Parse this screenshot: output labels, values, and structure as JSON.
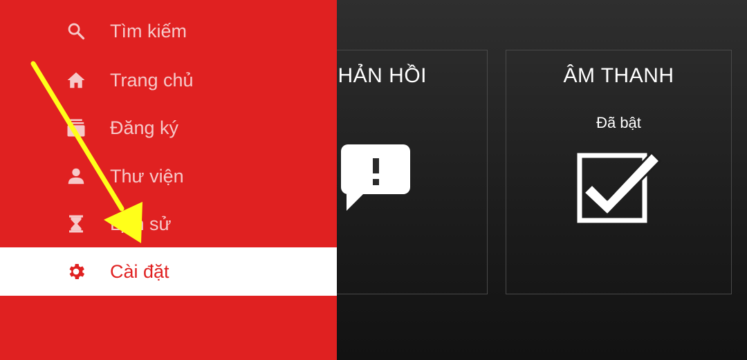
{
  "drawer": {
    "items": [
      {
        "label": "Tìm kiếm",
        "icon": "search-icon",
        "active": false
      },
      {
        "label": "Trang chủ",
        "icon": "home-icon",
        "active": false
      },
      {
        "label": "Đăng ký",
        "icon": "subscriptions-icon",
        "active": false
      },
      {
        "label": "Thư viện",
        "icon": "person-icon",
        "active": false
      },
      {
        "label": "Lịch sử",
        "icon": "hourglass-icon",
        "active": false
      },
      {
        "label": "Cài đặt",
        "icon": "gear-icon",
        "active": true
      }
    ]
  },
  "settings": {
    "feedback": {
      "title": "HẢN HỒI"
    },
    "sound": {
      "title": "ÂM THANH",
      "status": "Đã bật"
    }
  },
  "colors": {
    "drawer_bg": "#e02121",
    "active_bg": "#ffffff",
    "inactive_text": "#f6c9c9",
    "arrow": "#ffff1a"
  }
}
